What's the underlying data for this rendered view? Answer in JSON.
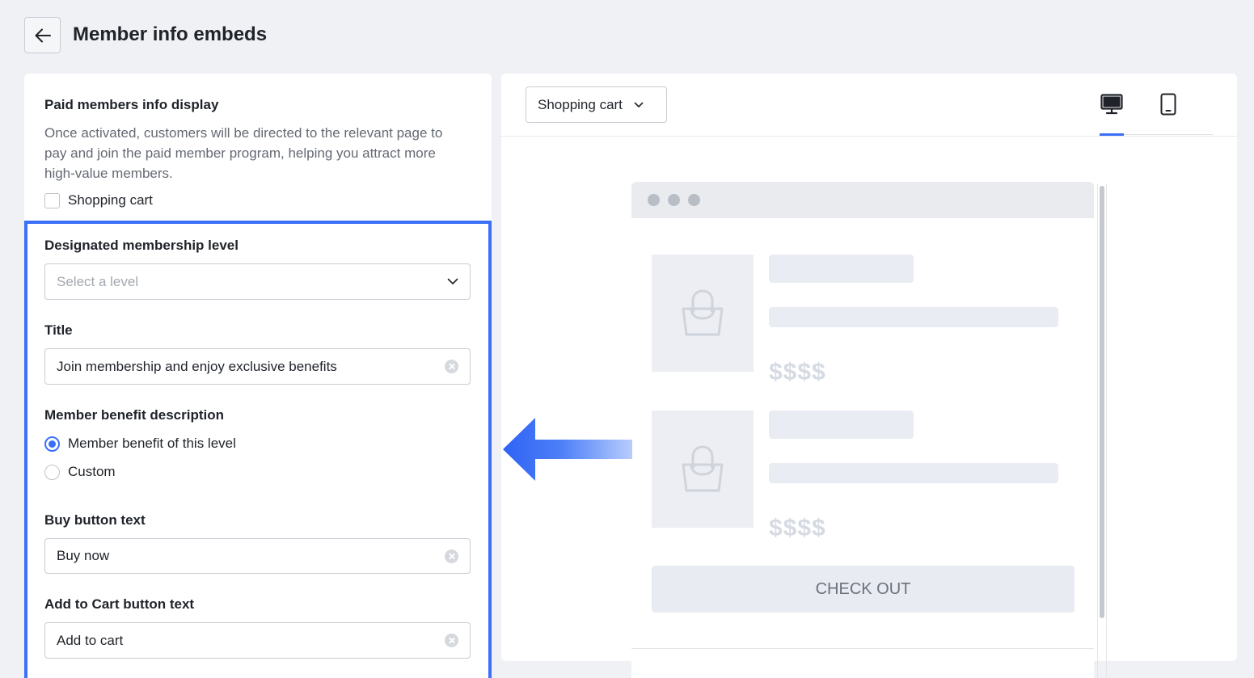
{
  "header": {
    "title": "Member info embeds"
  },
  "left": {
    "section_title": "Paid members info display",
    "description": "Once activated, customers will be directed to the relevant page to pay and join the paid member program, helping you attract more high-value members.",
    "shopping_cart_label": "Shopping cart",
    "shopping_cart_checked": false,
    "level_label": "Designated membership level",
    "level_placeholder": "Select a level",
    "title_label": "Title",
    "title_value": "Join membership and enjoy exclusive benefits",
    "benefit_label": "Member benefit description",
    "benefit_options": [
      "Member benefit of this level",
      "Custom"
    ],
    "benefit_selected": "Member benefit of this level",
    "buy_label": "Buy button text",
    "buy_value": "Buy now",
    "cart_label": "Add to Cart button text",
    "cart_value": "Add to cart"
  },
  "preview": {
    "page_select": "Shopping cart",
    "devices": [
      "desktop-icon",
      "mobile-icon"
    ],
    "active_device": "desktop",
    "products": [
      {
        "price": "$$$$"
      },
      {
        "price": "$$$$"
      }
    ],
    "checkout_label": "CHECK OUT"
  },
  "colors": {
    "accent": "#3a6ff7",
    "background": "#eff1f5"
  }
}
